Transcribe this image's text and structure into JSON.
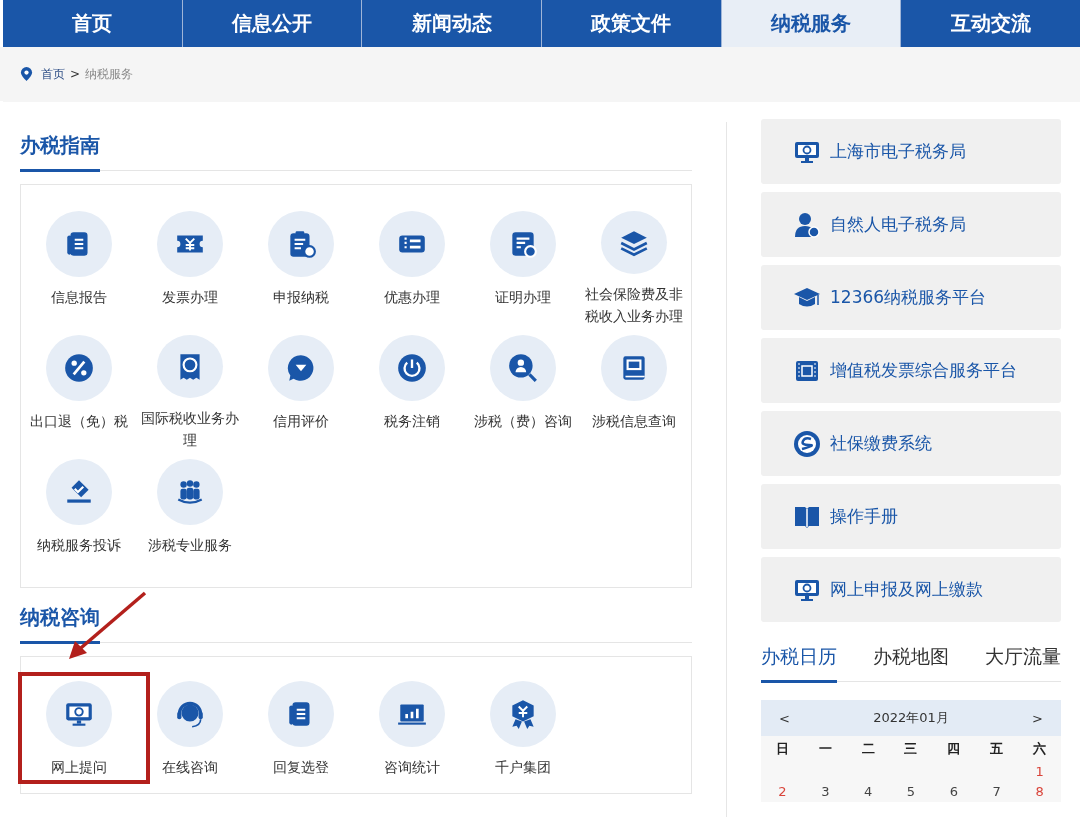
{
  "nav": [
    {
      "label": "首页",
      "selected": false
    },
    {
      "label": "信息公开",
      "selected": false
    },
    {
      "label": "新闻动态",
      "selected": false
    },
    {
      "label": "政策文件",
      "selected": false
    },
    {
      "label": "纳税服务",
      "selected": true
    },
    {
      "label": "互动交流",
      "selected": false
    }
  ],
  "breadcrumb": {
    "home": "首页",
    "separator": ">",
    "current": "纳税服务"
  },
  "guide": {
    "title": "办税指南",
    "items": [
      {
        "label": "信息报告"
      },
      {
        "label": "发票办理"
      },
      {
        "label": "申报纳税"
      },
      {
        "label": "优惠办理"
      },
      {
        "label": "证明办理"
      },
      {
        "label": "社会保险费及非税收入业务办理"
      },
      {
        "label": "出口退（免）税"
      },
      {
        "label": "国际税收业务办理"
      },
      {
        "label": "信用评价"
      },
      {
        "label": "税务注销"
      },
      {
        "label": "涉税（费）咨询"
      },
      {
        "label": "涉税信息查询"
      },
      {
        "label": "纳税服务投诉"
      },
      {
        "label": "涉税专业服务"
      }
    ]
  },
  "consult": {
    "title": "纳税咨询",
    "items": [
      {
        "label": "网上提问",
        "highlighted": true
      },
      {
        "label": "在线咨询",
        "highlighted": false
      },
      {
        "label": "回复选登",
        "highlighted": false
      },
      {
        "label": "咨询统计",
        "highlighted": false
      },
      {
        "label": "千户集团",
        "highlighted": false
      }
    ]
  },
  "links": [
    "上海市电子税务局",
    "自然人电子税务局",
    "12366纳税服务平台",
    "增值税发票综合服务平台",
    "社保缴费系统",
    "操作手册",
    "网上申报及网上缴款"
  ],
  "info_tabs": [
    {
      "label": "办税日历",
      "selected": true
    },
    {
      "label": "办税地图",
      "selected": false
    },
    {
      "label": "大厅流量",
      "selected": false
    }
  ],
  "calendar": {
    "prev": "<",
    "month": "2022年01月",
    "next": ">",
    "weekdays": [
      "日",
      "一",
      "二",
      "三",
      "四",
      "五",
      "六"
    ],
    "weeks": [
      [
        "1"
      ],
      [
        "2",
        "3",
        "4",
        "5",
        "6",
        "7",
        "8"
      ]
    ]
  }
}
